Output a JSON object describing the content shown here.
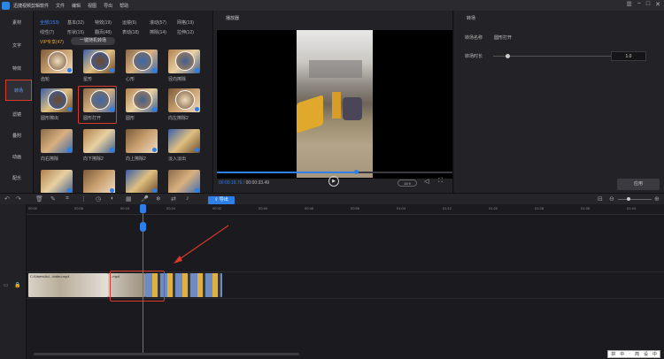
{
  "app": {
    "title": "迅捷视频剪辑软件",
    "menu": [
      "文件",
      "编辑",
      "视图",
      "导出",
      "帮助"
    ]
  },
  "nav": {
    "items": [
      {
        "label": "素材"
      },
      {
        "label": "文字"
      },
      {
        "label": "特效"
      },
      {
        "label": "转场",
        "active": true
      },
      {
        "label": "滤镜"
      },
      {
        "label": "叠附"
      },
      {
        "label": "动画"
      },
      {
        "label": "配乐"
      }
    ]
  },
  "assets": {
    "categories_row1": [
      {
        "label": "全部(153)",
        "selected": true
      },
      {
        "label": "基本(32)"
      },
      {
        "label": "特效(19)"
      },
      {
        "label": "运镜(6)"
      },
      {
        "label": "滚动(57)"
      },
      {
        "label": "网格(19)"
      }
    ],
    "categories_row2": [
      {
        "label": "线性(7)"
      },
      {
        "label": "形状(15)"
      },
      {
        "label": "翻页(48)"
      },
      {
        "label": "表动(18)"
      },
      {
        "label": "擦除(14)"
      },
      {
        "label": "拉伸(12)"
      }
    ],
    "vip": "VIP专享(47)",
    "one_click": "一键随机转场",
    "items": [
      {
        "label": "齿轮"
      },
      {
        "label": "星形"
      },
      {
        "label": "心形"
      },
      {
        "label": "径向擦除"
      },
      {
        "label": "圆形擦出"
      },
      {
        "label": "圆形打开",
        "selected": true
      },
      {
        "label": "圆形"
      },
      {
        "label": "向左擦除2"
      },
      {
        "label": "向右擦除"
      },
      {
        "label": "向下擦除2"
      },
      {
        "label": "向上擦除2"
      },
      {
        "label": "淡入淡出"
      },
      {
        "label": ""
      },
      {
        "label": ""
      },
      {
        "label": ""
      },
      {
        "label": ""
      }
    ]
  },
  "player": {
    "title": "播放器",
    "current_time": "00:00:19.76",
    "total_time": "00:00:33.49",
    "progress": 0.59,
    "aspect": "16:9"
  },
  "props": {
    "title": "转场",
    "name_label": "转场名称",
    "name_value": "圆形打开",
    "duration_label": "转场时长",
    "duration_value": "1.0",
    "slider_value": 0.1,
    "apply_label": "应用"
  },
  "toolbar": {
    "export_label": "导出"
  },
  "timeline": {
    "ticks": [
      "00:00",
      "00:08",
      "00:16",
      "00:24",
      "00:32",
      "00:40",
      "00:48",
      "00:56",
      "01:04",
      "01:12",
      "01:20",
      "01:28",
      "01:36",
      "01:44"
    ],
    "clip1_label": "C:\\Users\\Ad...\\video.mp4",
    "clip2_label": "...mp4"
  },
  "status": [
    "拼",
    "中",
    "·",
    "简",
    "设",
    "中"
  ],
  "colors": {
    "accent": "#2e7fe8",
    "highlight": "#d83b2b"
  }
}
